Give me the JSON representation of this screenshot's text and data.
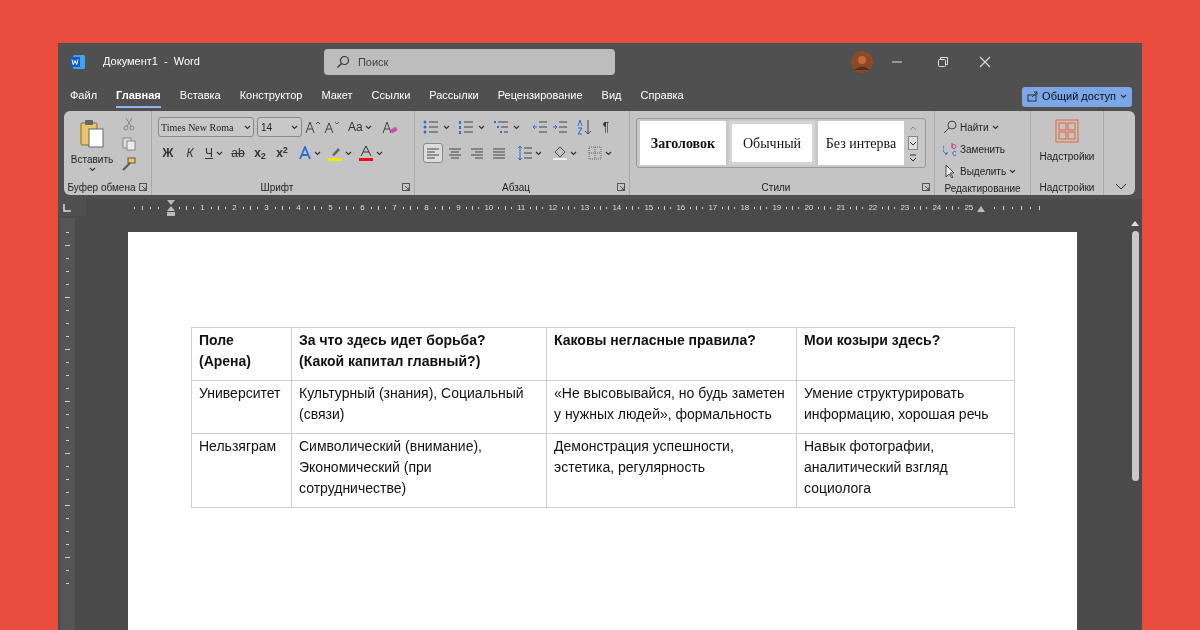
{
  "window": {
    "title": "Документ1  -  Word",
    "search_placeholder": "Поиск"
  },
  "menu_tabs": [
    {
      "label": "Файл",
      "selected": false
    },
    {
      "label": "Главная",
      "selected": true
    },
    {
      "label": "Вставка",
      "selected": false
    },
    {
      "label": "Конструктор",
      "selected": false
    },
    {
      "label": "Макет",
      "selected": false
    },
    {
      "label": "Ссылки",
      "selected": false
    },
    {
      "label": "Рассылки",
      "selected": false
    },
    {
      "label": "Рецензирование",
      "selected": false
    },
    {
      "label": "Вид",
      "selected": false
    },
    {
      "label": "Справка",
      "selected": false
    }
  ],
  "share_button": "Общий доступ",
  "clipboard": {
    "paste": "Вставить",
    "label": "Буфер обмена"
  },
  "font": {
    "font_name": "Times New Roma",
    "font_size": "14",
    "case_button": "Aa",
    "bold": "Ж",
    "italic": "К",
    "underline": "Ч",
    "strike": "ab",
    "subscript": "x$_{2}$",
    "superscript": "x$^{2}$",
    "label": "Шрифт"
  },
  "paragraph": {
    "pilcrow": "¶",
    "align": [
      {
        "kind": "left",
        "selected": true
      },
      {
        "kind": "center",
        "selected": false
      },
      {
        "kind": "right",
        "selected": false
      },
      {
        "kind": "justify",
        "selected": false
      }
    ],
    "label": "Абзац"
  },
  "styles": {
    "items": [
      {
        "label": "Заголовок",
        "kind": "heading",
        "selected": false
      },
      {
        "label": "Обычный",
        "kind": "normal",
        "selected": true
      },
      {
        "label": "Без интерва",
        "kind": "normal",
        "selected": false
      }
    ],
    "label": "Стили"
  },
  "editing": {
    "items": [
      {
        "label": "Найти",
        "kind": "find"
      },
      {
        "label": "Заменить",
        "kind": "replace"
      },
      {
        "label": "Выделить",
        "kind": "select"
      }
    ],
    "label": "Редактирование"
  },
  "addins": {
    "button": "Надстройки",
    "label": "Надстройки"
  },
  "ruler": [
    "1",
    "2",
    "3",
    "4",
    "5",
    "6",
    "7",
    "8",
    "9",
    "10",
    "11",
    "12",
    "13",
    "14",
    "15",
    "16",
    "17",
    "18",
    "19",
    "20",
    "21",
    "22",
    "23",
    "24",
    "25"
  ],
  "table": {
    "columns": [
      "Поле (Арена)",
      "За что здесь идет борьба?\n(Какой капитал главный?)",
      "Каковы негласные правила?",
      "Мои козыри здесь?"
    ],
    "rows": [
      [
        "Университет",
        "Культурный (знания), Социальный (связи)",
        "«Не высовывайся, но будь заметен у нужных людей», формальность",
        "Умение структурировать информацию, хорошая речь"
      ],
      [
        "Нельзяграм",
        "Символический (внимание), Экономический (при сотрудничестве)",
        "Демонстрация успешности, эстетика, регулярность",
        "Навык фотографии, аналитический взгляд социолога"
      ]
    ]
  }
}
